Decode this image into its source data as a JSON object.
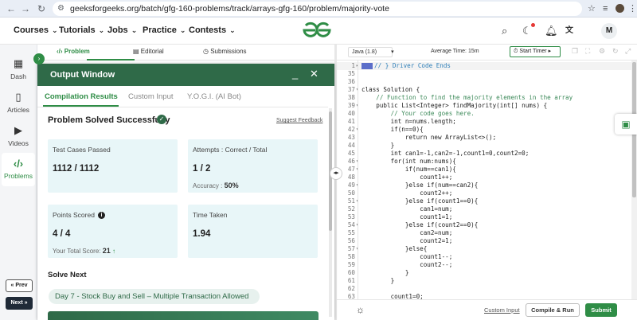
{
  "browser": {
    "url": "geeksforgeeks.org/batch/gfg-160-problems/track/arrays-gfg-160/problem/majority-vote"
  },
  "header": {
    "menu": [
      {
        "label": "Courses"
      },
      {
        "label": "Tutorials"
      },
      {
        "label": "Jobs"
      },
      {
        "label": "Practice"
      },
      {
        "label": "Contests"
      }
    ],
    "logo_text": "GfG",
    "avatar_letter": "M",
    "brand_color": "#2f8d46"
  },
  "rail": {
    "items": [
      {
        "label": "Dash",
        "icon": "dashboard-icon"
      },
      {
        "label": "Articles",
        "icon": "book-icon"
      },
      {
        "label": "Videos",
        "icon": "video-icon"
      },
      {
        "label": "Problems",
        "icon": "code-icon"
      }
    ],
    "prev_label": "« Prev",
    "next_label": "Next »"
  },
  "tabs": {
    "problem": "Problem",
    "editorial": "Editorial",
    "submissions": "Submissions"
  },
  "output": {
    "title": "Output Window",
    "tabs": [
      "Compilation Results",
      "Custom Input",
      "Y.O.G.I. (AI Bot)"
    ],
    "result_title": "Problem Solved Successfully",
    "suggest_feedback": "Suggest Feedback",
    "cards": {
      "tests": {
        "label": "Test Cases Passed",
        "value": "1112 / 1112"
      },
      "attempts": {
        "label": "Attempts : Correct / Total",
        "value": "1 / 2",
        "sub_label": "Accuracy :",
        "sub_value": "50%"
      },
      "points": {
        "label": "Points Scored",
        "value": "4 / 4",
        "sub_label": "Your Total Score:",
        "sub_value": "21"
      },
      "time": {
        "label": "Time Taken",
        "value": "1.94"
      }
    },
    "solve_next_heading": "Solve Next",
    "next_problem": "Day 7 - Stock Buy and Sell – Multiple Transaction Allowed"
  },
  "editor": {
    "language": "Java (1.8)",
    "average_time": "Average Time: 15m",
    "start_timer": "Start Timer",
    "lines": [
      {
        "n": "1",
        "fold": "▸",
        "text": "// } Driver Code Ends"
      },
      {
        "n": "35",
        "fold": "",
        "text": ""
      },
      {
        "n": "36",
        "fold": "",
        "text": ""
      },
      {
        "n": "37",
        "fold": "▾",
        "text": "class Solution {"
      },
      {
        "n": "38",
        "fold": "",
        "text": "    // Function to find the majority elements in the array"
      },
      {
        "n": "39",
        "fold": "▾",
        "text": "    public List<Integer> findMajority(int[] nums) {"
      },
      {
        "n": "40",
        "fold": "",
        "text": "        // Your code goes here."
      },
      {
        "n": "41",
        "fold": "",
        "text": "        int n=nums.length;"
      },
      {
        "n": "42",
        "fold": "▾",
        "text": "        if(n==0){"
      },
      {
        "n": "43",
        "fold": "",
        "text": "            return new ArrayList<>();"
      },
      {
        "n": "44",
        "fold": "",
        "text": "        }"
      },
      {
        "n": "45",
        "fold": "",
        "text": "        int can1=-1,can2=-1,count1=0,count2=0;"
      },
      {
        "n": "46",
        "fold": "▾",
        "text": "        for(int num:nums){"
      },
      {
        "n": "47",
        "fold": "▾",
        "text": "            if(num==can1){"
      },
      {
        "n": "48",
        "fold": "",
        "text": "                count1++;"
      },
      {
        "n": "49",
        "fold": "▾",
        "text": "            }else if(num==can2){"
      },
      {
        "n": "50",
        "fold": "",
        "text": "                count2++;"
      },
      {
        "n": "51",
        "fold": "▾",
        "text": "            }else if(count1==0){"
      },
      {
        "n": "52",
        "fold": "",
        "text": "                can1=num;"
      },
      {
        "n": "53",
        "fold": "",
        "text": "                count1=1;"
      },
      {
        "n": "54",
        "fold": "▾",
        "text": "            }else if(count2==0){"
      },
      {
        "n": "55",
        "fold": "",
        "text": "                can2=num;"
      },
      {
        "n": "56",
        "fold": "",
        "text": "                count2=1;"
      },
      {
        "n": "57",
        "fold": "▾",
        "text": "            }else{"
      },
      {
        "n": "58",
        "fold": "",
        "text": "                count1--;"
      },
      {
        "n": "59",
        "fold": "",
        "text": "                count2--;"
      },
      {
        "n": "60",
        "fold": "",
        "text": "            }"
      },
      {
        "n": "61",
        "fold": "",
        "text": "        }"
      },
      {
        "n": "62",
        "fold": "",
        "text": ""
      },
      {
        "n": "63",
        "fold": "",
        "text": "        count1=0;"
      }
    ],
    "custom_input": "Custom Input",
    "compile_run": "Compile & Run",
    "submit": "Submit"
  }
}
